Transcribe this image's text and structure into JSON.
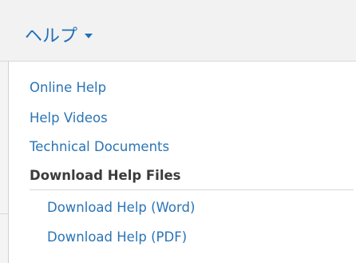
{
  "menu": {
    "title": "ヘルプ",
    "toggle_icon": "chevron-down-icon",
    "accent_color": "#1f70b8"
  },
  "dropdown": {
    "links": [
      {
        "label": "Online Help"
      },
      {
        "label": "Help Videos"
      },
      {
        "label": "Technical Documents"
      }
    ],
    "download_heading": "Download Help Files",
    "downloads": [
      {
        "label": "Download Help (Word)"
      },
      {
        "label": "Download Help (PDF)"
      }
    ]
  }
}
